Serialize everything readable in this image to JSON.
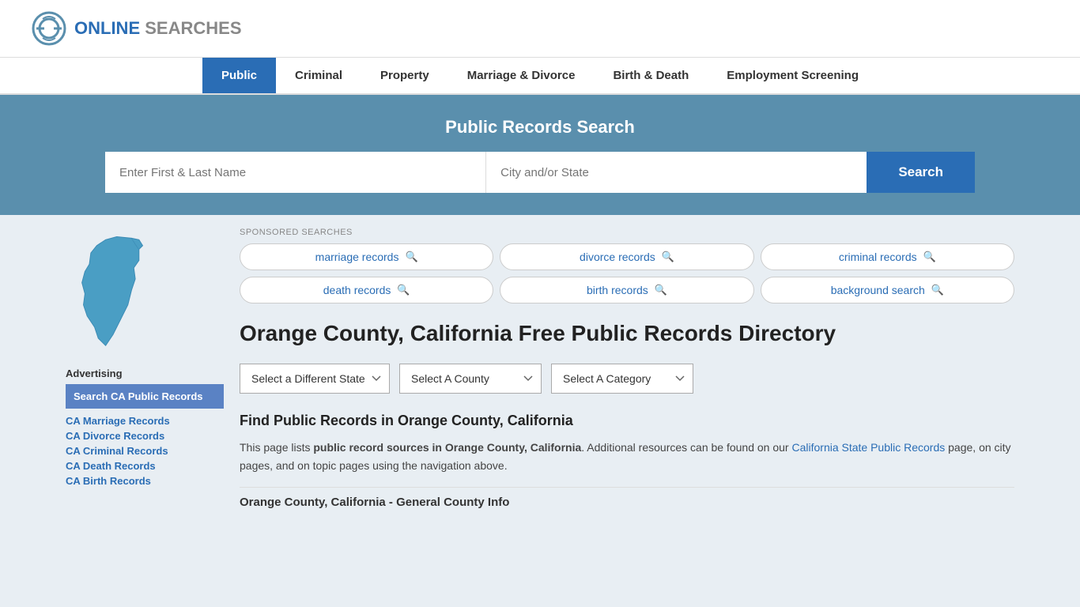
{
  "logo": {
    "text_online": "ONLINE",
    "text_searches": "SEARCHES"
  },
  "nav": {
    "items": [
      {
        "label": "Public",
        "active": true
      },
      {
        "label": "Criminal",
        "active": false
      },
      {
        "label": "Property",
        "active": false
      },
      {
        "label": "Marriage & Divorce",
        "active": false
      },
      {
        "label": "Birth & Death",
        "active": false
      },
      {
        "label": "Employment Screening",
        "active": false
      }
    ]
  },
  "hero": {
    "title": "Public Records Search",
    "name_placeholder": "Enter First & Last Name",
    "location_placeholder": "City and/or State",
    "search_button": "Search"
  },
  "sponsored": {
    "label": "SPONSORED SEARCHES",
    "items": [
      {
        "label": "marriage records"
      },
      {
        "label": "divorce records"
      },
      {
        "label": "criminal records"
      },
      {
        "label": "death records"
      },
      {
        "label": "birth records"
      },
      {
        "label": "background search"
      }
    ]
  },
  "page": {
    "title": "Orange County, California Free Public Records Directory",
    "dropdowns": {
      "state": "Select a Different State",
      "county": "Select A County",
      "category": "Select A Category"
    },
    "find_title": "Find Public Records in Orange County, California",
    "find_text_1": "This page lists ",
    "find_text_bold": "public record sources in Orange County, California",
    "find_text_2": ". Additional resources can be found on our ",
    "find_link_text": "California State Public Records",
    "find_text_3": " page, on city pages, and on topic pages using the navigation above.",
    "general_info_label": "Orange County, California - General County Info"
  },
  "sidebar": {
    "ad_label": "Advertising",
    "ad_box_text": "Search CA Public Records",
    "links": [
      {
        "label": "CA Marriage Records"
      },
      {
        "label": "CA Divorce Records"
      },
      {
        "label": "CA Criminal Records"
      },
      {
        "label": "CA Death Records"
      },
      {
        "label": "CA Birth Records"
      }
    ]
  }
}
